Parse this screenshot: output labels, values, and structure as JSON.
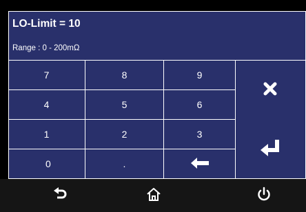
{
  "header": {
    "title": "LO-Limit = 10",
    "range": "Range : 0 - 200mΩ"
  },
  "keypad": {
    "digits": [
      "7",
      "8",
      "9",
      "4",
      "5",
      "6",
      "1",
      "2",
      "3"
    ],
    "zero": "0",
    "dot": "."
  },
  "icons": {
    "backspace": "backspace-arrow-icon",
    "clear": "close-icon",
    "enter": "enter-icon",
    "back": "back-arrow-icon",
    "home": "home-icon",
    "power": "power-icon"
  },
  "colors": {
    "panel": "#29306b",
    "background": "#000000",
    "navbar": "#151515",
    "text": "#ffffff"
  }
}
